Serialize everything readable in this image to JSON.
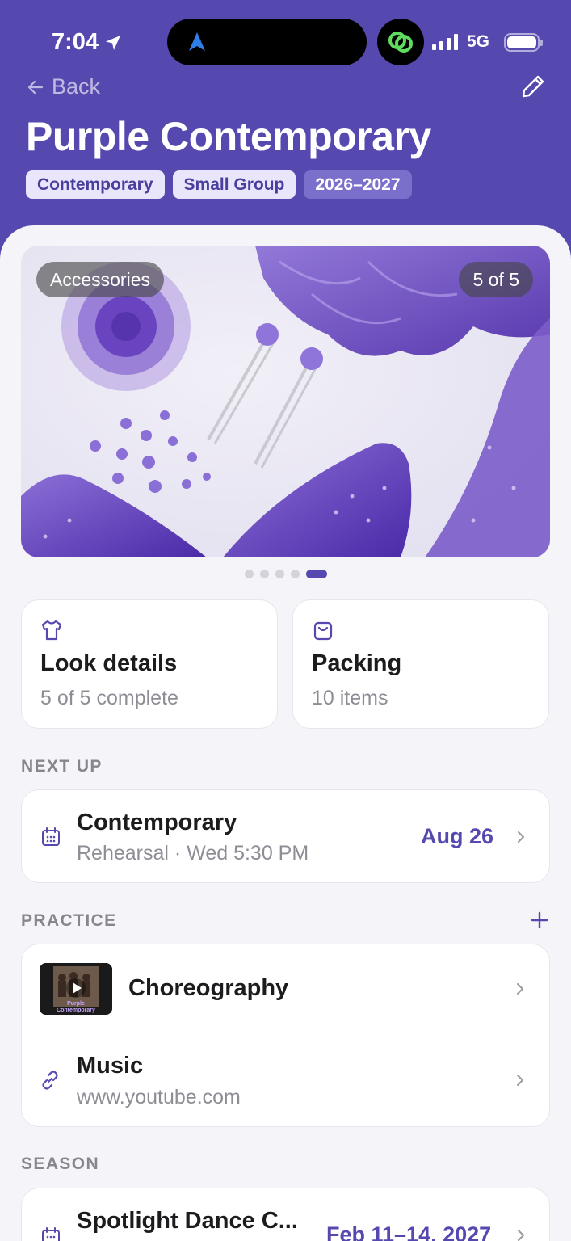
{
  "status_bar": {
    "time": "7:04",
    "network": "5G"
  },
  "header": {
    "back_label": "Back",
    "title": "Purple Contemporary",
    "tags": [
      "Contemporary",
      "Small Group",
      "2026–2027"
    ]
  },
  "colors": {
    "brand": "#5549b0",
    "accent_date": "#5549b0",
    "background": "#f4f4f9"
  },
  "carousel": {
    "category": "Accessories",
    "counter": "5 of 5",
    "page_count": 5,
    "active_page": 5
  },
  "look_card": {
    "icon": "shirt-icon",
    "title": "Look details",
    "subtitle": "5 of 5 complete"
  },
  "packing_card": {
    "icon": "bag-icon",
    "title": "Packing",
    "subtitle": "10 items"
  },
  "next_up": {
    "heading": "NEXT UP",
    "event": {
      "icon": "calendar-icon",
      "title": "Contemporary",
      "subtitle": "Rehearsal · Wed 5:30 PM",
      "date": "Aug 26"
    }
  },
  "practice": {
    "heading": "PRACTICE",
    "items": [
      {
        "title": "Choreography",
        "thumb_caption": "Purple Contemporary"
      },
      {
        "icon": "link-icon",
        "title": "Music",
        "subtitle": "www.youtube.com"
      }
    ]
  },
  "season": {
    "heading": "SEASON",
    "event": {
      "icon": "calendar-icon",
      "title": "Spotlight Dance C...",
      "date": "Feb 11–14, 2027"
    }
  }
}
